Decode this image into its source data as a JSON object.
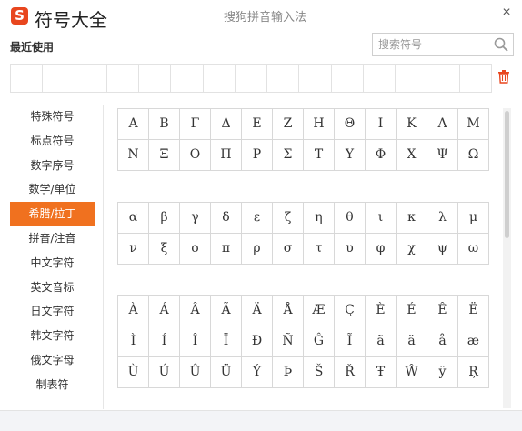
{
  "app": {
    "logo_letter": "S",
    "title": "符号大全",
    "ime_name": "搜狗拼音输入法"
  },
  "window_controls": {
    "close": "×"
  },
  "recent": {
    "label": "最近使用",
    "cell_count": 15
  },
  "search": {
    "placeholder": "搜索符号"
  },
  "sidebar": {
    "items": [
      {
        "label": "特殊符号",
        "active": false
      },
      {
        "label": "标点符号",
        "active": false
      },
      {
        "label": "数字序号",
        "active": false
      },
      {
        "label": "数学/单位",
        "active": false
      },
      {
        "label": "希腊/拉丁",
        "active": true
      },
      {
        "label": "拼音/注音",
        "active": false
      },
      {
        "label": "中文字符",
        "active": false
      },
      {
        "label": "英文音标",
        "active": false
      },
      {
        "label": "日文字符",
        "active": false
      },
      {
        "label": "韩文字符",
        "active": false
      },
      {
        "label": "俄文字母",
        "active": false
      },
      {
        "label": "制表符",
        "active": false
      }
    ]
  },
  "symbol_groups": [
    {
      "name": "greek-upper",
      "symbols": [
        "Α",
        "Β",
        "Γ",
        "Δ",
        "Ε",
        "Ζ",
        "Η",
        "Θ",
        "Ι",
        "Κ",
        "Λ",
        "Μ",
        "Ν",
        "Ξ",
        "Ο",
        "Π",
        "Ρ",
        "Σ",
        "Τ",
        "Υ",
        "Φ",
        "Χ",
        "Ψ",
        "Ω"
      ]
    },
    {
      "name": "greek-lower",
      "symbols": [
        "α",
        "β",
        "γ",
        "δ",
        "ε",
        "ζ",
        "η",
        "θ",
        "ι",
        "κ",
        "λ",
        "μ",
        "ν",
        "ξ",
        "ο",
        "π",
        "ρ",
        "σ",
        "τ",
        "υ",
        "φ",
        "χ",
        "ψ",
        "ω"
      ]
    },
    {
      "name": "latin-accented",
      "symbols": [
        "À",
        "Á",
        "Â",
        "Ã",
        "Ä",
        "Å",
        "Æ",
        "Ç",
        "È",
        "É",
        "Ê",
        "Ë",
        "Ì",
        "Í",
        "Î",
        "Ï",
        "Ð",
        "Ñ",
        "Ĝ",
        "Ĩ",
        "ã",
        "ä",
        "å",
        "æ",
        "Ù",
        "Ú",
        "Û",
        "Ü",
        "Ý",
        "Þ",
        "Š",
        "Ř",
        "Ŧ",
        "Ŵ",
        "ÿ",
        "Ŗ"
      ]
    }
  ],
  "colors": {
    "accent": "#f0711f",
    "logo": "#e8461e",
    "trash": "#e8461e"
  }
}
